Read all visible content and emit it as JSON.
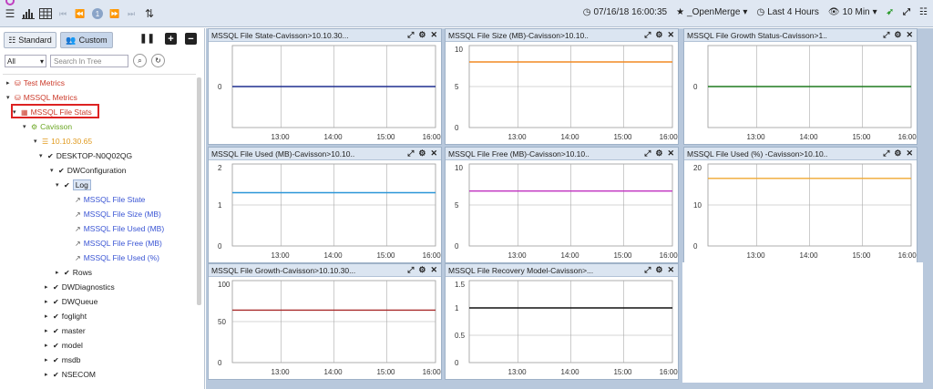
{
  "toolbar": {
    "menu_icon": "hamburger-icon",
    "chart_icon": "bar-chart-icon",
    "table_icon": "grid-icon",
    "nav": [
      "first-page-icon",
      "prev-page-icon",
      "page-1",
      "next-page-icon",
      "last-page-icon",
      "sort-icon"
    ],
    "page": "1",
    "datetime": "07/16/18 16:00:35",
    "favorite": "_OpenMerge",
    "range": "Last 4 Hours",
    "interval": "10 Min"
  },
  "left": {
    "tab_standard": "Standard",
    "tab_custom": "Custom",
    "filter": "All",
    "search_placeholder": "Search In Tree",
    "tree": [
      {
        "label": "Test Metrics",
        "color": "#cc3b2b",
        "icon": "db-icon",
        "arrow": "▸"
      },
      {
        "label": "MSSQL Metrics",
        "color": "#cc3b2b",
        "icon": "db-icon",
        "arrow": "▾"
      },
      {
        "label": "MSSQL File Stats",
        "color": "#cc3b2b",
        "icon": "grid-icon",
        "arrow": "▾"
      },
      {
        "label": "Cavisson",
        "color": "#6aa622",
        "icon": "gear-icon",
        "arrow": "▾"
      },
      {
        "label": "10.10.30.65",
        "color": "#e09a1e",
        "icon": "server-icon",
        "arrow": "▾"
      },
      {
        "label": "DESKTOP-N0Q02QG",
        "color": "#222",
        "icon": "check-icon",
        "arrow": "▾"
      },
      {
        "label": "DWConfiguration",
        "color": "#222",
        "icon": "check-icon",
        "arrow": "▾"
      },
      {
        "label": "Log",
        "color": "#222",
        "icon": "check-icon",
        "arrow": "▾"
      },
      {
        "label": "MSSQL File State",
        "color": "#3a55d4",
        "icon": "line-icon",
        "arrow": ""
      },
      {
        "label": "MSSQL File Size (MB)",
        "color": "#3a55d4",
        "icon": "line-icon",
        "arrow": ""
      },
      {
        "label": "MSSQL File Used (MB)",
        "color": "#3a55d4",
        "icon": "line-icon",
        "arrow": ""
      },
      {
        "label": "MSSQL File Free (MB)",
        "color": "#3a55d4",
        "icon": "line-icon",
        "arrow": ""
      },
      {
        "label": "MSSQL File Used (%)",
        "color": "#3a55d4",
        "icon": "line-icon",
        "arrow": ""
      },
      {
        "label": "Rows",
        "color": "#222",
        "icon": "check-icon",
        "arrow": "▸"
      },
      {
        "label": "DWDiagnostics",
        "color": "#222",
        "icon": "check-icon",
        "arrow": "▸"
      },
      {
        "label": "DWQueue",
        "color": "#222",
        "icon": "check-icon",
        "arrow": "▸"
      },
      {
        "label": "foglight",
        "color": "#222",
        "icon": "check-icon",
        "arrow": "▸"
      },
      {
        "label": "master",
        "color": "#222",
        "icon": "check-icon",
        "arrow": "▸"
      },
      {
        "label": "model",
        "color": "#222",
        "icon": "check-icon",
        "arrow": "▸"
      },
      {
        "label": "msdb",
        "color": "#222",
        "icon": "check-icon",
        "arrow": "▸"
      },
      {
        "label": "NSECOM",
        "color": "#222",
        "icon": "check-icon",
        "arrow": "▸"
      }
    ]
  },
  "chart_data": [
    {
      "type": "line",
      "title": "MSSQL File State-Cavisson>10.10.30...",
      "x": [
        "13:00",
        "14:00",
        "15:00",
        "16:00"
      ],
      "yticks": [
        "0"
      ],
      "ylim": [
        -1,
        1
      ],
      "series": [
        {
          "values": [
            0,
            0,
            0,
            0,
            0
          ],
          "color": "#1f2e8f"
        }
      ]
    },
    {
      "type": "line",
      "title": "MSSQL File Size (MB)-Cavisson>10.10..",
      "x": [
        "13:00",
        "14:00",
        "15:00",
        "16:00"
      ],
      "yticks": [
        "10",
        "5",
        "0"
      ],
      "ylim": [
        0,
        10
      ],
      "series": [
        {
          "values": [
            8,
            8,
            8,
            8,
            8
          ],
          "color": "#f28a23"
        }
      ]
    },
    {
      "type": "line",
      "title": "MSSQL File Growth Status-Cavisson>1..",
      "x": [
        "13:00",
        "14:00",
        "15:00",
        "16:00"
      ],
      "yticks": [
        "0"
      ],
      "ylim": [
        -1,
        1
      ],
      "series": [
        {
          "values": [
            0,
            0,
            0,
            0,
            0
          ],
          "color": "#1f7a1f"
        }
      ]
    },
    {
      "type": "line",
      "title": "MSSQL File Used (MB)-Cavisson>10.10..",
      "x": [
        "13:00",
        "14:00",
        "15:00",
        "16:00"
      ],
      "yticks": [
        "2",
        "1",
        "0"
      ],
      "ylim": [
        0,
        2
      ],
      "series": [
        {
          "values": [
            1.3,
            1.3,
            1.3,
            1.3,
            1.3
          ],
          "color": "#2a96d8"
        }
      ]
    },
    {
      "type": "line",
      "title": "MSSQL File Free (MB)-Cavisson>10.10..",
      "x": [
        "13:00",
        "14:00",
        "15:00",
        "16:00"
      ],
      "yticks": [
        "10",
        "5",
        "0"
      ],
      "ylim": [
        0,
        10
      ],
      "series": [
        {
          "values": [
            6.7,
            6.7,
            6.7,
            6.7,
            6.7
          ],
          "color": "#c030c0"
        }
      ]
    },
    {
      "type": "line",
      "title": "MSSQL File Used (%) -Cavisson>10.10..",
      "x": [
        "13:00",
        "14:00",
        "15:00",
        "16:00"
      ],
      "yticks": [
        "20",
        "10",
        "0"
      ],
      "ylim": [
        0,
        20
      ],
      "series": [
        {
          "values": [
            16.5,
            16.5,
            16.5,
            16.5,
            16.5
          ],
          "color": "#f0a830"
        }
      ]
    },
    {
      "type": "line",
      "title": "MSSQL File Growth-Cavisson>10.10.30...",
      "x": [
        "13:00",
        "14:00",
        "15:00",
        "16:00"
      ],
      "yticks": [
        "100",
        "50",
        "0"
      ],
      "ylim": [
        0,
        100
      ],
      "series": [
        {
          "values": [
            64,
            64,
            64,
            64,
            64
          ],
          "color": "#a82a2a"
        }
      ]
    },
    {
      "type": "line",
      "title": "MSSQL File Recovery Model-Cavisson>...",
      "x": [
        "13:00",
        "14:00",
        "15:00",
        "16:00"
      ],
      "yticks": [
        "1.5",
        "1",
        "0.5",
        "0"
      ],
      "ylim": [
        0,
        1.5
      ],
      "series": [
        {
          "values": [
            1,
            1,
            1,
            1,
            1
          ],
          "color": "#111111"
        }
      ]
    }
  ]
}
